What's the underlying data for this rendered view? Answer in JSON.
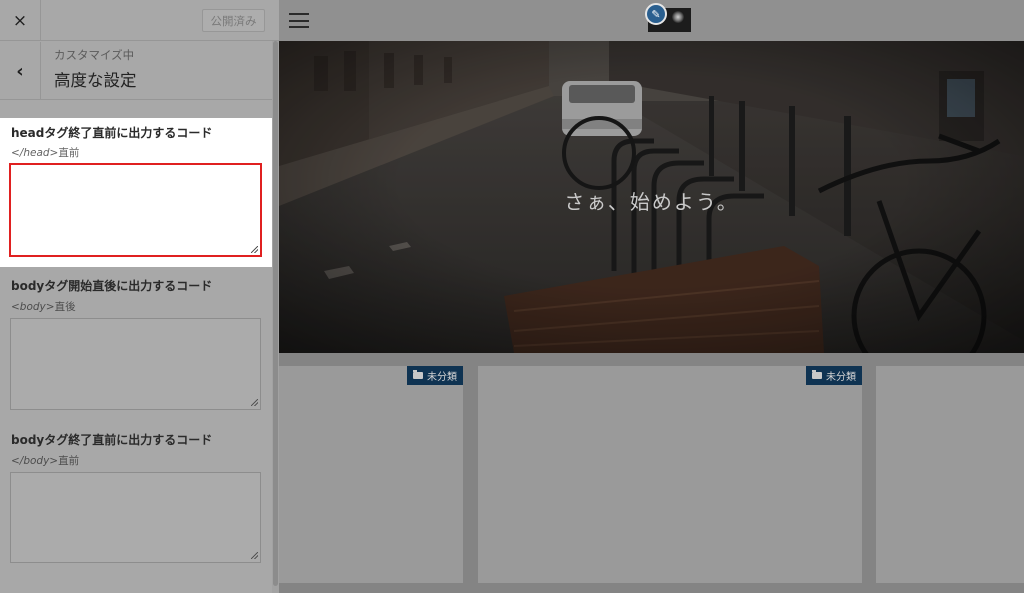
{
  "customizer": {
    "close_icon": "×",
    "publish_label": "公開済み",
    "back_icon": "‹",
    "breadcrumb": "カスタマイズ中",
    "section_title": "高度な設定",
    "fields": [
      {
        "label": "headタグ終了直前に出力するコード",
        "tag": "</head>",
        "suffix": "直前",
        "value": ""
      },
      {
        "label": "bodyタグ開始直後に出力するコード",
        "tag": "<body>",
        "suffix": "直後",
        "value": ""
      },
      {
        "label": "bodyタグ終了直前に出力するコード",
        "tag": "</body>",
        "suffix": "直前",
        "value": ""
      }
    ]
  },
  "preview": {
    "hero_text": "さぁ、始めよう。",
    "cards": [
      {
        "category": "未分類"
      },
      {
        "category": "未分類"
      }
    ]
  },
  "colors": {
    "highlight_border": "#e02020",
    "badge_bg": "#0f3352",
    "edit_button": "#2a5f8f"
  }
}
